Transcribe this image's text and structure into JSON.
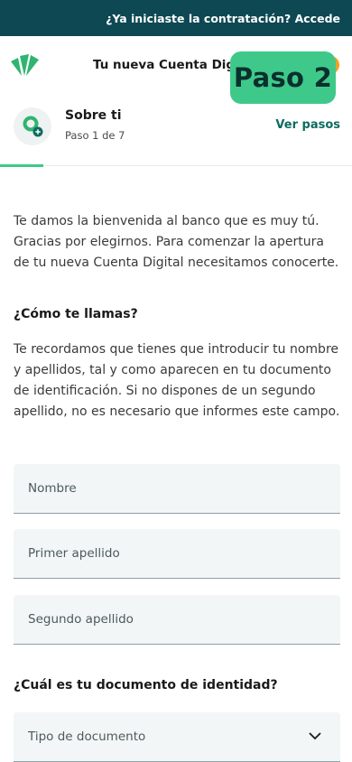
{
  "topbar": {
    "link_text": "¿Ya iniciaste la contratación? Accede"
  },
  "header": {
    "title": "Tu nueva Cuenta Digital",
    "badge": "Paso 2"
  },
  "step": {
    "title": "Sobre ti",
    "subtitle": "Paso 1 de 7",
    "action": "Ver pasos"
  },
  "intro": "Te damos la bienvenida al banco que es muy tú. Gracias por elegirnos. Para comenzar la apertura de tu nueva Cuenta Digital necesitamos conocerte.",
  "name_section": {
    "title": "¿Cómo te llamas?",
    "help": "Te recordamos que tienes que introducir tu nombre y apellidos, tal y como aparecen en tu documento de identificación. Si no dispones de un segundo apellido, no es necesario que informes este campo."
  },
  "fields": {
    "nombre": {
      "placeholder": "Nombre",
      "value": ""
    },
    "primer_apellido": {
      "placeholder": "Primer apellido",
      "value": ""
    },
    "segundo_apellido": {
      "placeholder": "Segundo apellido",
      "value": ""
    }
  },
  "document_section": {
    "title": "¿Cuál es tu documento de identidad?",
    "select_label": "Tipo de documento"
  },
  "colors": {
    "topbar": "#0d4853",
    "accent": "#3ec98a",
    "link": "#0d6b5e",
    "field_bg": "#f3f6f6"
  }
}
